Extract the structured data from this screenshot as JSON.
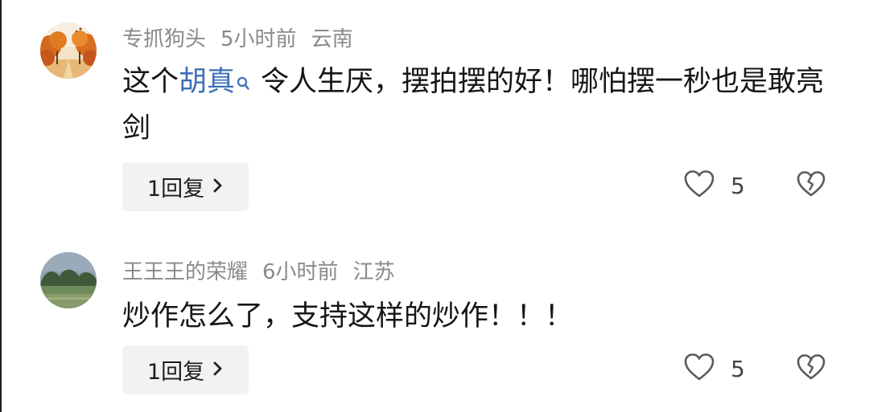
{
  "comments": [
    {
      "username": "专抓狗头",
      "time": "5小时前",
      "location": "云南",
      "text_before": "这个",
      "link_text": "胡真",
      "text_after": "令人生厌，摆拍摆的好！哪怕摆一秒也是敢亮剑",
      "reply_label": "1回复",
      "likes": "5",
      "avatar": "autumn-trees-avatar"
    },
    {
      "username": "王王王的荣耀",
      "time": "6小时前",
      "location": "江苏",
      "text": "炒作怎么了，支持这样的炒作！！！",
      "reply_label": "1回复",
      "likes": "5",
      "avatar": "landscape-avatar"
    }
  ],
  "icons": {
    "like": "heart-outline-icon",
    "dislike": "broken-heart-icon",
    "reply_chevron": "chevron-right-icon",
    "link_search": "search-icon"
  },
  "colors": {
    "link": "#3d6fb6",
    "meta": "#8a8a8a",
    "reply_bg": "#f2f2f2"
  }
}
